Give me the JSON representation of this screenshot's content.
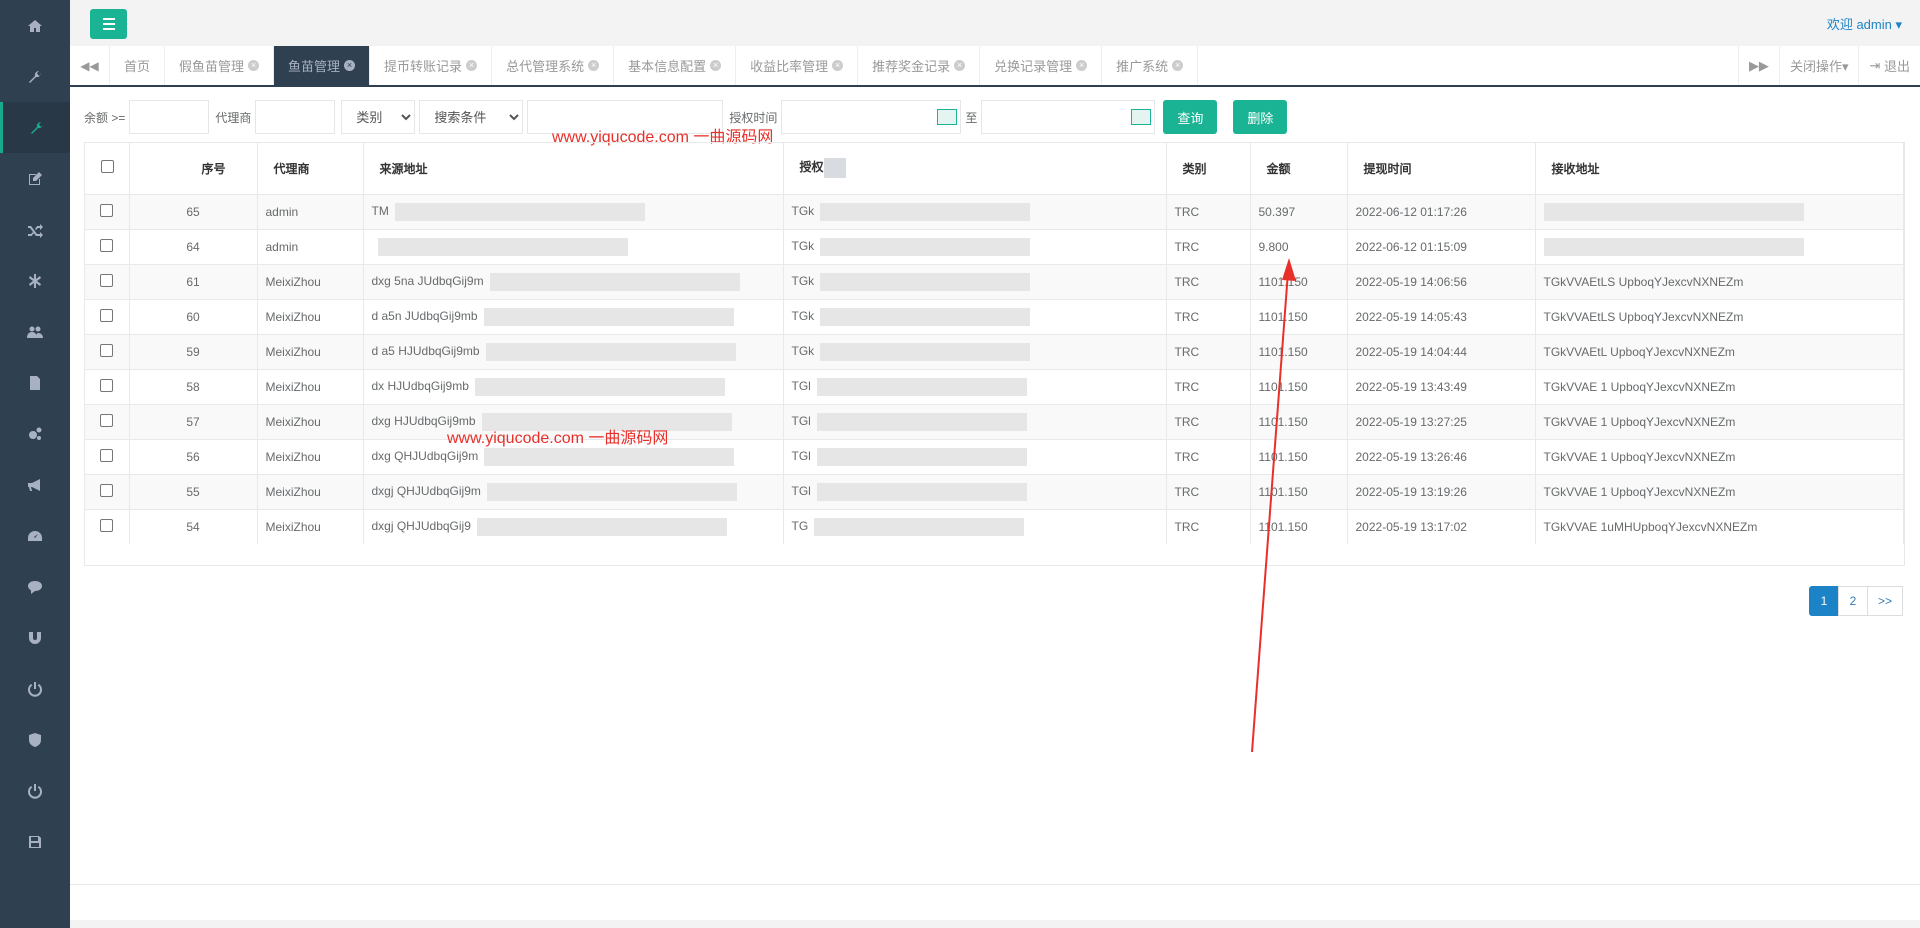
{
  "header": {
    "welcome": "欢迎 admin ▾"
  },
  "sidebar": {
    "icons": [
      "home-icon",
      "wrench-icon",
      "wrench-active-icon",
      "edit-icon",
      "shuffle-icon",
      "asterisk-icon",
      "users-icon",
      "file-icon",
      "cogs-icon",
      "bullhorn-icon",
      "dashboard-icon",
      "comment-icon",
      "magnet-icon",
      "power-icon",
      "shield-icon",
      "power-icon",
      "save-icon"
    ]
  },
  "tabs": {
    "prev": "◀◀",
    "items": [
      {
        "label": "首页",
        "closable": false
      },
      {
        "label": "假鱼苗管理",
        "closable": true
      },
      {
        "label": "鱼苗管理",
        "closable": true,
        "active": true
      },
      {
        "label": "提币转账记录",
        "closable": true
      },
      {
        "label": "总代管理系统",
        "closable": true
      },
      {
        "label": "基本信息配置",
        "closable": true
      },
      {
        "label": "收益比率管理",
        "closable": true
      },
      {
        "label": "推荐奖金记录",
        "closable": true
      },
      {
        "label": "兑换记录管理",
        "closable": true
      },
      {
        "label": "推广系统",
        "closable": true
      }
    ],
    "next": "▶▶",
    "close_ops": "关闭操作▾",
    "logout": "退出"
  },
  "filter": {
    "balance_label": "余额 >=",
    "agent_label": "代理商",
    "category_select": "类别",
    "search_select": "搜索条件",
    "auth_time_label": "授权时间",
    "to_label": "至",
    "query_button": "查询",
    "delete_button": "删除"
  },
  "watermarks": [
    "www.yiqucode.com  一曲源码网",
    "www.yiqucode.com  一曲源码网"
  ],
  "table": {
    "columns": [
      "序号",
      "代理商",
      "来源地址",
      "授权",
      "类别",
      "金额",
      "提现时间",
      "接收地址"
    ],
    "rows": [
      {
        "id": "65",
        "agent": "admin",
        "src": "TM",
        "auth": "TGk",
        "type": "TRC",
        "amount": "50.397",
        "time": "2022-06-12 01:17:26",
        "recv": ""
      },
      {
        "id": "64",
        "agent": "admin",
        "src": "",
        "auth": "TGk",
        "type": "TRC",
        "amount": "9.800",
        "time": "2022-06-12 01:15:09",
        "recv": ""
      },
      {
        "id": "61",
        "agent": "MeixiZhou",
        "src": "dxg  5na  JUdbqGij9m",
        "auth": "TGk",
        "type": "TRC",
        "amount": "1101.150",
        "time": "2022-05-19 14:06:56",
        "recv": "TGkVVAEtLS  UpboqYJexcvNXNEZm"
      },
      {
        "id": "60",
        "agent": "MeixiZhou",
        "src": "d  a5n  JUdbqGij9mb",
        "auth": "TGk",
        "type": "TRC",
        "amount": "1101.150",
        "time": "2022-05-19 14:05:43",
        "recv": "TGkVVAEtLS  UpboqYJexcvNXNEZm"
      },
      {
        "id": "59",
        "agent": "MeixiZhou",
        "src": "d  a5  HJUdbqGij9mb",
        "auth": "TGk",
        "type": "TRC",
        "amount": "1101.150",
        "time": "2022-05-19 14:04:44",
        "recv": "TGkVVAEtL  UpboqYJexcvNXNEZm"
      },
      {
        "id": "58",
        "agent": "MeixiZhou",
        "src": "dx  HJUdbqGij9mb",
        "auth": "TGl",
        "type": "TRC",
        "amount": "1101.150",
        "time": "2022-05-19 13:43:49",
        "recv": "TGkVVAE  1  UpboqYJexcvNXNEZm"
      },
      {
        "id": "57",
        "agent": "MeixiZhou",
        "src": "dxg  HJUdbqGij9mb",
        "auth": "TGl",
        "type": "TRC",
        "amount": "1101.150",
        "time": "2022-05-19 13:27:25",
        "recv": "TGkVVAE  1  UpboqYJexcvNXNEZm"
      },
      {
        "id": "56",
        "agent": "MeixiZhou",
        "src": "dxg  QHJUdbqGij9m",
        "auth": "TGl",
        "type": "TRC",
        "amount": "1101.150",
        "time": "2022-05-19 13:26:46",
        "recv": "TGkVVAE  1  UpboqYJexcvNXNEZm"
      },
      {
        "id": "55",
        "agent": "MeixiZhou",
        "src": "dxgj  QHJUdbqGij9m",
        "auth": "TGl",
        "type": "TRC",
        "amount": "1101.150",
        "time": "2022-05-19 13:19:26",
        "recv": "TGkVVAE  1  UpboqYJexcvNXNEZm"
      },
      {
        "id": "54",
        "agent": "MeixiZhou",
        "src": "dxgj  QHJUdbqGij9",
        "auth": "TG",
        "type": "TRC",
        "amount": "1101.150",
        "time": "2022-05-19 13:17:02",
        "recv": "TGkVVAE  1uMHUpboqYJexcvNXNEZm"
      }
    ]
  },
  "pagination": [
    "1",
    "2",
    ">>"
  ],
  "colors": {
    "sidebar": "#2f4050",
    "accent": "#1ab394",
    "link": "#1c84c6",
    "watermark": "#e8302a",
    "arrow": "#e8302a"
  }
}
